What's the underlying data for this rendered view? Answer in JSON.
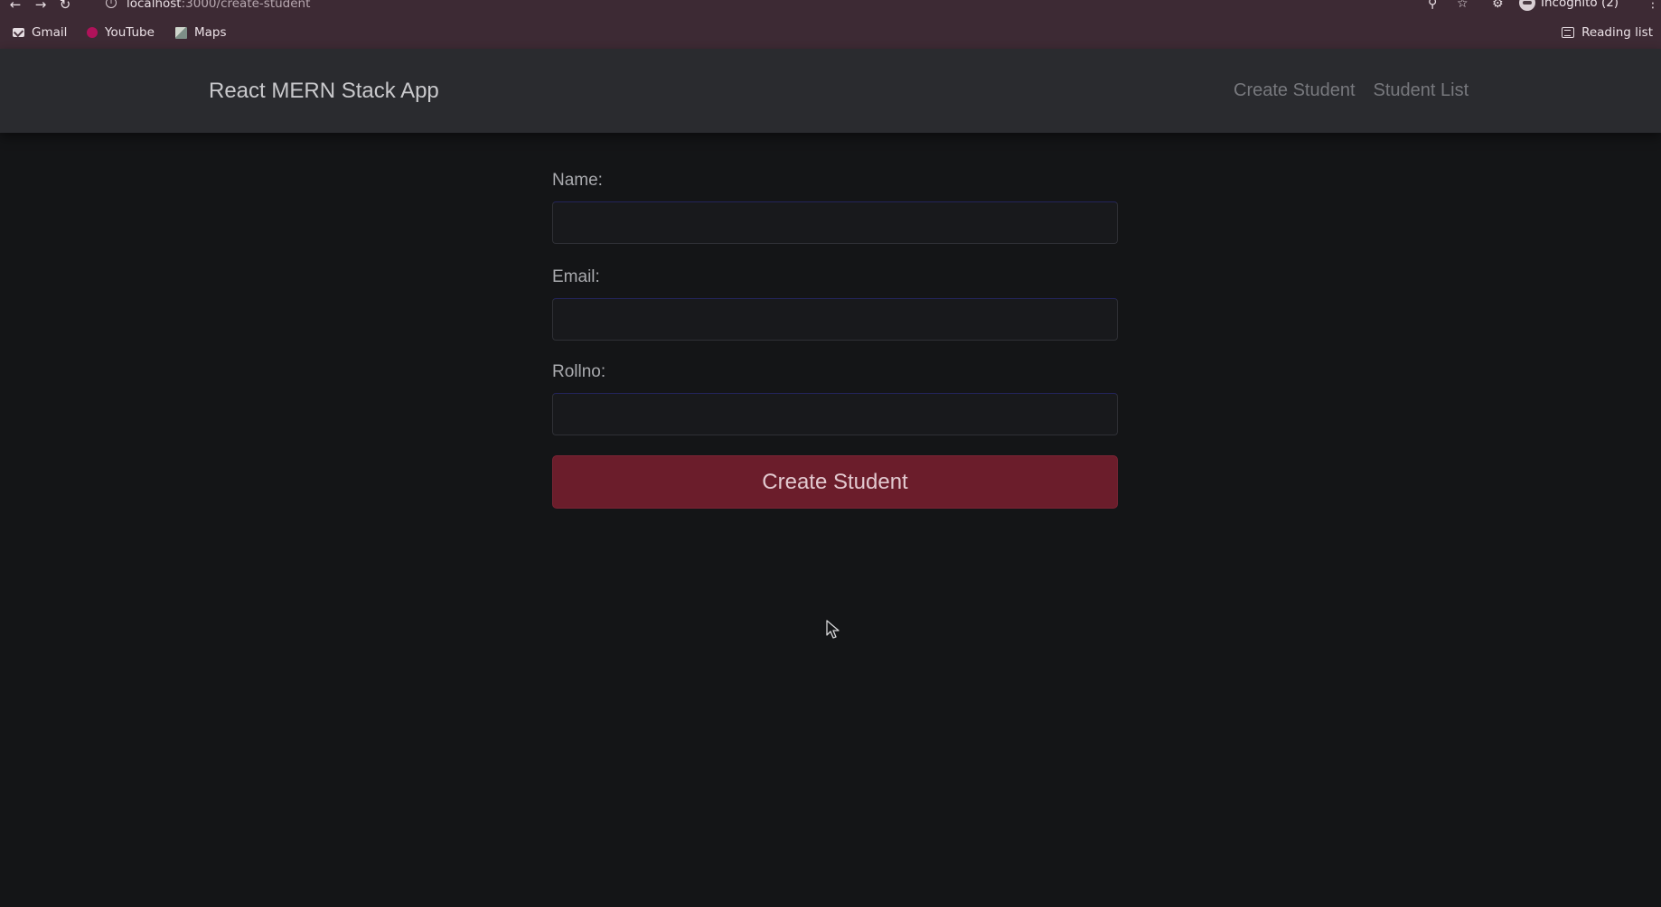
{
  "browser": {
    "url_host": "localhost",
    "url_path": ":3000/create-student",
    "profile_label": "Incognito (2)",
    "icons": [
      "back-arrow-icon",
      "forward-arrow-icon",
      "reload-icon",
      "info-icon",
      "zoom-icon",
      "star-icon",
      "extensions-icon",
      "incognito-icon",
      "menu-dots-icon"
    ],
    "bookmarks": [
      {
        "label": "Gmail",
        "icon": "gmail-icon"
      },
      {
        "label": "YouTube",
        "icon": "youtube-icon"
      },
      {
        "label": "Maps",
        "icon": "maps-icon"
      }
    ],
    "reading_list_label": "Reading list"
  },
  "navbar": {
    "brand": "React MERN Stack App",
    "links": [
      {
        "label": "Create Student"
      },
      {
        "label": "Student List"
      }
    ]
  },
  "form": {
    "name": {
      "label": "Name:",
      "value": ""
    },
    "email": {
      "label": "Email:",
      "value": ""
    },
    "rollno": {
      "label": "Rollno:",
      "value": ""
    },
    "submit_label": "Create Student"
  },
  "colors": {
    "page_background": "#141517",
    "navbar_background": "#2a2b2f",
    "browser_chrome": "#3d2a34",
    "submit_button": "#6b1d2b"
  }
}
